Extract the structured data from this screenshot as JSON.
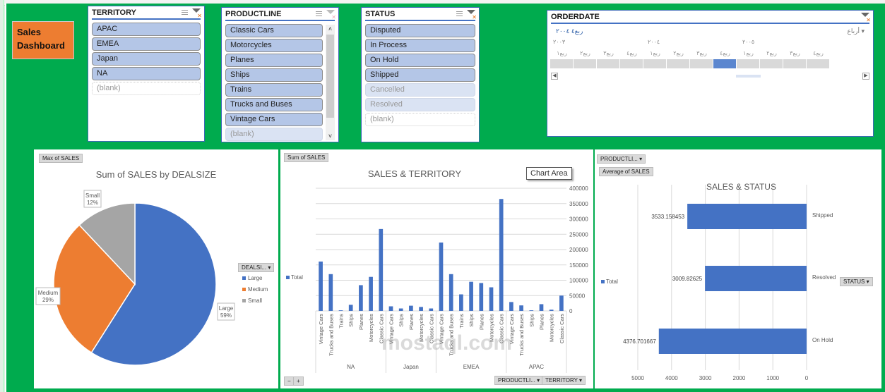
{
  "dashboard_title": "Sales Dashboard",
  "colors": {
    "background_green": "#00ab4e",
    "title_orange": "#ed7d31",
    "bar_blue": "#4472c4",
    "slicer_selected": "#b4c6e7",
    "pie_large": "#4472c4",
    "pie_medium": "#ed7d31",
    "pie_small": "#a5a5a5"
  },
  "slicers": {
    "territory": {
      "title": "TERRITORY",
      "items": [
        {
          "label": "APAC",
          "state": "selected"
        },
        {
          "label": "EMEA",
          "state": "selected"
        },
        {
          "label": "Japan",
          "state": "selected"
        },
        {
          "label": "NA",
          "state": "selected"
        },
        {
          "label": "(blank)",
          "state": "blank"
        }
      ]
    },
    "productline": {
      "title": "PRODUCTLINE",
      "items": [
        {
          "label": "Classic Cars",
          "state": "selected"
        },
        {
          "label": "Motorcycles",
          "state": "selected"
        },
        {
          "label": "Planes",
          "state": "selected"
        },
        {
          "label": "Ships",
          "state": "selected"
        },
        {
          "label": "Trains",
          "state": "selected"
        },
        {
          "label": "Trucks and Buses",
          "state": "selected"
        },
        {
          "label": "Vintage Cars",
          "state": "selected"
        },
        {
          "label": "(blank)",
          "state": "nodata"
        }
      ]
    },
    "status": {
      "title": "STATUS",
      "items": [
        {
          "label": "Disputed",
          "state": "selected"
        },
        {
          "label": "In Process",
          "state": "selected"
        },
        {
          "label": "On Hold",
          "state": "selected"
        },
        {
          "label": "Shipped",
          "state": "selected"
        },
        {
          "label": "Cancelled",
          "state": "nodata"
        },
        {
          "label": "Resolved",
          "state": "nodata"
        },
        {
          "label": "(blank)",
          "state": "blank"
        }
      ]
    }
  },
  "timeline": {
    "title": "ORDERDATE",
    "selection_label": "ربع٤ ٢٠٠٤",
    "level_label": "أرباع",
    "years": [
      "٢٠٠٣",
      "٢٠٠٤",
      "٢٠٠٥"
    ],
    "quarters": [
      "ربع١",
      "ربع٢",
      "ربع٣",
      "ربع٤",
      "ربع١",
      "ربع٢",
      "ربع٣",
      "ربع٤",
      "ربع١",
      "ربع٢",
      "ربع٣",
      "ربع٤"
    ],
    "selected_index": 7
  },
  "pie": {
    "field_button": "Max of SALES",
    "legend_button": "DEALSI...",
    "chart_data": {
      "type": "pie",
      "title": "Sum of SALES by DEALSIZE",
      "categories": [
        "Large",
        "Medium",
        "Small"
      ],
      "values": [
        59,
        29,
        12
      ],
      "labels": [
        "Large\n59%",
        "Medium\n29%",
        "Small\n12%"
      ],
      "legend": "right"
    }
  },
  "territory_chart": {
    "field_button": "Sum of SALES",
    "tooltip": "Chart Area",
    "legend_label": "Total",
    "bottom_buttons": [
      "PRODUCTLI...",
      "TERRITORY"
    ],
    "zoom_buttons": [
      "−",
      "+"
    ],
    "chart_data": {
      "type": "bar",
      "title": "SALES & TERRITORY",
      "groups": [
        {
          "name": "NA",
          "categories": [
            "Vintage Cars",
            "Trucks and Buses",
            "Trains",
            "Ships",
            "Planes",
            "Motorcycles",
            "Classic Cars"
          ],
          "values": [
            161000,
            120000,
            2000,
            20000,
            84000,
            111000,
            267000
          ]
        },
        {
          "name": "Japan",
          "categories": [
            "Vintage Cars",
            "Ships",
            "Planes",
            "Motorcycles",
            "Classic Cars"
          ],
          "values": [
            15000,
            8000,
            17000,
            13000,
            8000
          ]
        },
        {
          "name": "EMEA",
          "categories": [
            "Vintage Cars",
            "Trucks and Buses",
            "Trains",
            "Ships",
            "Planes",
            "Motorcycles",
            "Classic Cars"
          ],
          "values": [
            223000,
            120000,
            54000,
            95000,
            91000,
            77000,
            365000
          ]
        },
        {
          "name": "APAC",
          "categories": [
            "Vintage Cars",
            "Trucks and Buses",
            "Ships",
            "Planes",
            "Motorcycles",
            "Classic Cars"
          ],
          "values": [
            29000,
            18000,
            2000,
            22000,
            4000,
            50000
          ]
        }
      ],
      "ylim": [
        0,
        400000
      ],
      "yticks": [
        "0",
        "50000",
        "100000",
        "150000",
        "200000",
        "250000",
        "300000",
        "350000",
        "400000"
      ],
      "y_axis_side": "right",
      "grid": true,
      "legend": "left"
    }
  },
  "status_chart": {
    "field_button_top": "PRODUCTLI...",
    "field_button": "Average of SALES",
    "legend_label": "Total",
    "status_button": "STATUS",
    "chart_data": {
      "type": "bar",
      "orientation": "horizontal-reversed",
      "title": "SALES & STATUS",
      "categories": [
        "Shipped",
        "Resolved",
        "On Hold"
      ],
      "values": [
        3533.158453,
        3009.82625,
        4376.701667
      ],
      "data_labels": [
        "3533.158453",
        "3009.82625",
        "4376.701667"
      ],
      "xlim": [
        0,
        5000
      ],
      "xticks": [
        "5000",
        "4000",
        "3000",
        "2000",
        "1000",
        "0"
      ],
      "grid": true,
      "legend": "left"
    }
  },
  "watermark": "mostaql.com"
}
